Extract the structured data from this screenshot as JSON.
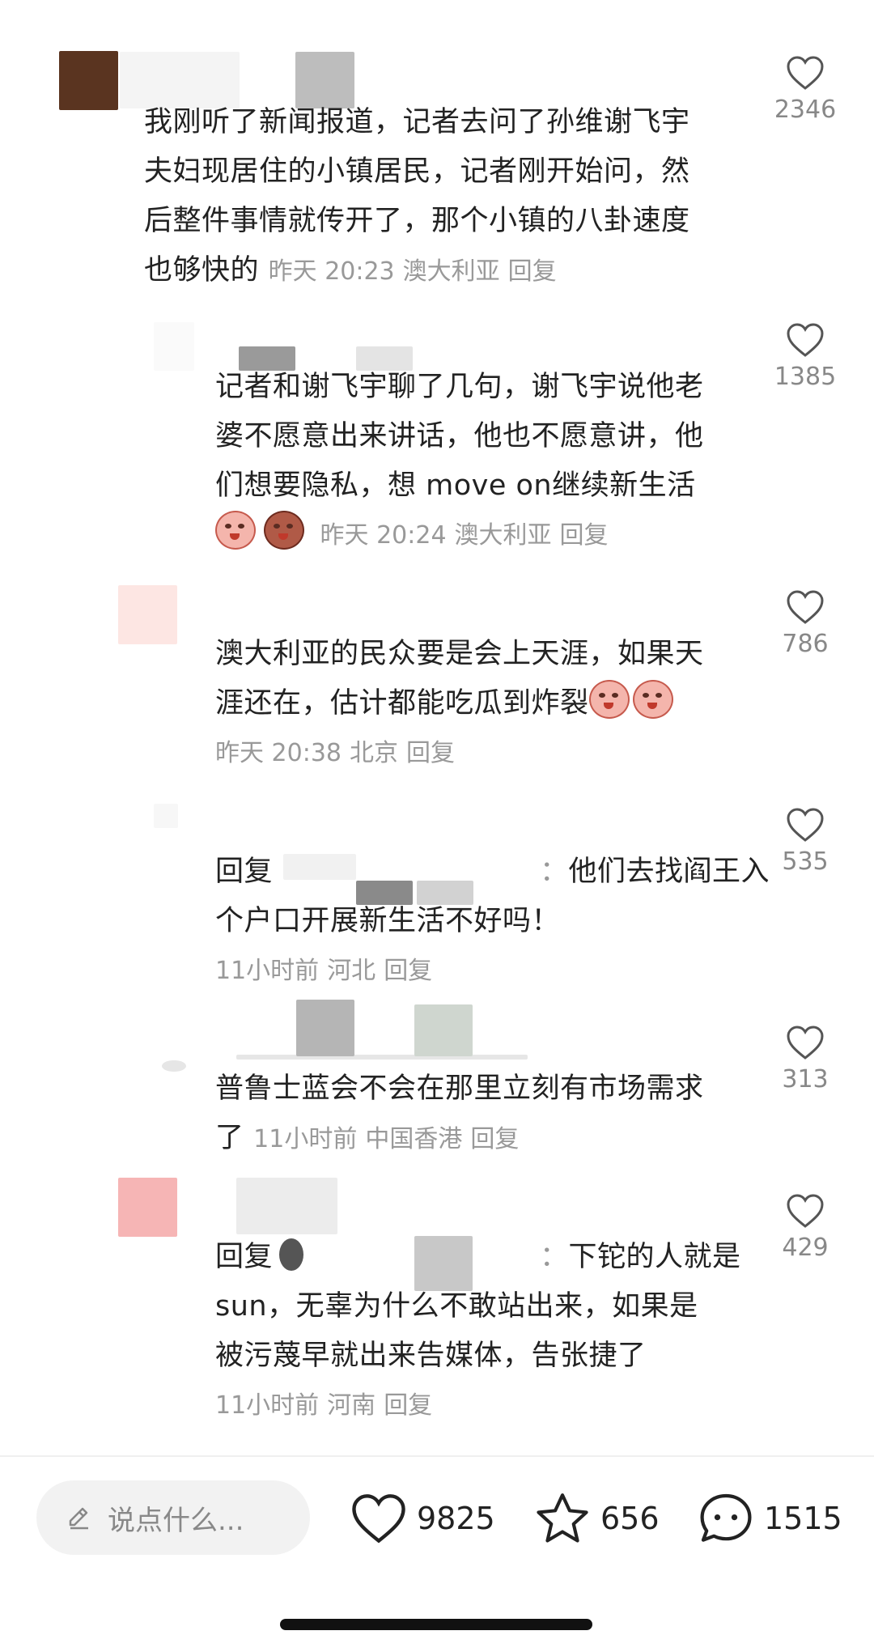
{
  "comments": [
    {
      "text_lines": [
        "我刚听了新闻报道，记者去问了孙维谢飞宇",
        "夫妇现居住的小镇居民，记者刚开始问，然",
        "后整件事情就传开了，那个小镇的八卦速度",
        "也够快的"
      ],
      "time": "昨天 20:23",
      "location": "澳大利亚",
      "reply": "回复",
      "likes": "2346"
    },
    {
      "text_lines": [
        "记者和谢飞宇聊了几句，谢飞宇说他老",
        "婆不愿意出来讲话，他也不愿意讲，他",
        "们想要隐私，想 move on继续新生活"
      ],
      "time": "昨天 20:24",
      "location": "澳大利亚",
      "reply": "回复",
      "likes": "1385"
    },
    {
      "text_lines": [
        "澳大利亚的民众要是会上天涯，如果天",
        "涯还在，估计都能吃瓜到炸裂"
      ],
      "time": "昨天 20:38",
      "location": "北京",
      "reply": "回复",
      "likes": "786"
    },
    {
      "prefix": "回复",
      "colon": "：",
      "text_lines": [
        "他们去找阎王入",
        "个户口开展新生活不好吗！"
      ],
      "time": "11小时前",
      "location": "河北",
      "reply": "回复",
      "likes": "535"
    },
    {
      "text_lines": [
        "普鲁士蓝会不会在那里立刻有市场需求",
        "了"
      ],
      "time": "11小时前",
      "location": "中国香港",
      "reply": "回复",
      "likes": "313"
    },
    {
      "prefix": "回复",
      "colon": "：",
      "text_lines": [
        "下铊的人就是",
        "sun，无辜为什么不敢站出来，如果是",
        "被污蔑早就出来告媒体，告张捷了"
      ],
      "time": "11小时前",
      "location": "河南",
      "reply": "回复",
      "likes": "429"
    }
  ],
  "bottom_bar": {
    "input_placeholder": "说点什么...",
    "likes": "9825",
    "favorites": "656",
    "comments": "1515"
  },
  "icons": {
    "like": "heart-outline-icon",
    "favorite": "star-outline-icon",
    "comment": "speech-bubble-icon",
    "edit": "pencil-icon"
  },
  "colors": {
    "text": "#222222",
    "meta": "#999999",
    "background": "#ffffff"
  }
}
